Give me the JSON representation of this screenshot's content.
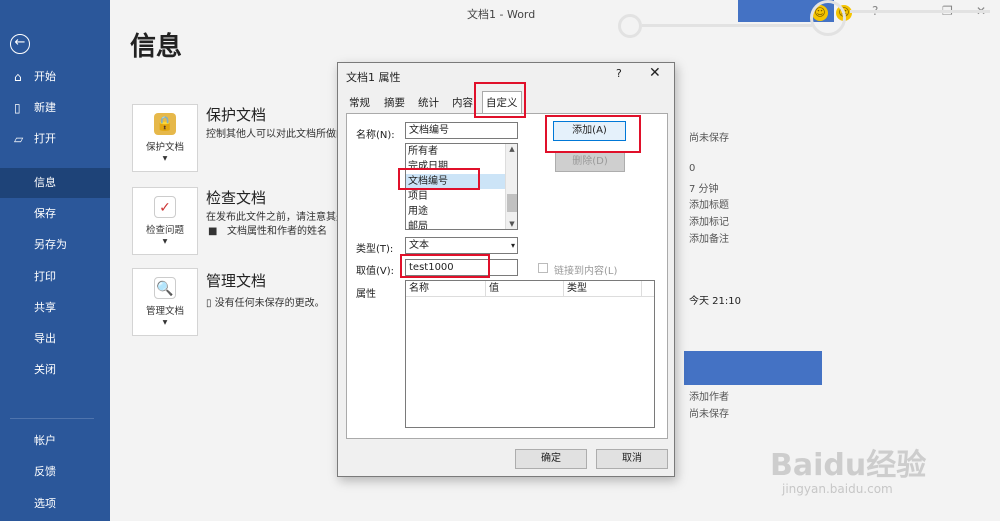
{
  "window": {
    "title": "文档1  -  Word"
  },
  "sidebar": {
    "back_icon": "back-arrow-icon",
    "items": [
      {
        "label": "开始",
        "icon": "home-icon"
      },
      {
        "label": "新建",
        "icon": "new-doc-icon"
      },
      {
        "label": "打开",
        "icon": "folder-icon"
      },
      {
        "label": "信息"
      },
      {
        "label": "保存"
      },
      {
        "label": "另存为"
      },
      {
        "label": "打印"
      },
      {
        "label": "共享"
      },
      {
        "label": "导出"
      },
      {
        "label": "关闭"
      },
      {
        "label": "帐户"
      },
      {
        "label": "反馈"
      },
      {
        "label": "选项"
      }
    ],
    "active": "信息"
  },
  "main": {
    "heading": "信息",
    "cards": [
      {
        "button_label": "保护文档",
        "title": "保护文档",
        "desc": "控制其他人可以对此文档所做的"
      },
      {
        "button_label": "检查问题",
        "title": "检查文档",
        "desc": "在发布此文件之前，请注意其是",
        "desc2": "文档属性和作者的姓名"
      },
      {
        "button_label": "管理文档",
        "title": "管理文档",
        "desc": "没有任何未保存的更改。"
      }
    ],
    "properties": {
      "unsaved": "尚未保存",
      "pages": "0",
      "edit_time": "7 分钟",
      "add_title": "添加标题",
      "add_tag": "添加标记",
      "add_comment": "添加备注",
      "today": "今天 21:10",
      "add_author": "添加作者",
      "last_saved": "尚未保存"
    }
  },
  "dialog": {
    "title": "文档1 属性",
    "help": "?",
    "close": "✕",
    "tabs": [
      "常规",
      "摘要",
      "统计",
      "内容",
      "自定义"
    ],
    "active_tab": "自定义",
    "name_label": "名称(N):",
    "name_value": "文档编号",
    "name_options": [
      "所有者",
      "完成日期",
      "文档编号",
      "项目",
      "用途",
      "邮局"
    ],
    "selected_option": "文档编号",
    "add_button": "添加(A)",
    "delete_button": "删除(D)",
    "type_label": "类型(T):",
    "type_value": "文本",
    "value_label": "取值(V):",
    "value_value": "test1000",
    "link_label": "链接到内容(L)",
    "props_label": "属性",
    "grid_headers": [
      "名称",
      "值",
      "类型"
    ],
    "ok_button": "确定",
    "cancel_button": "取消"
  },
  "watermark": {
    "main": "Baidu经验",
    "sub": "jingyan.baidu.com"
  },
  "colors": {
    "sidebar": "#2b579a",
    "accent": "#4472c4",
    "annotation": "#e0102a"
  }
}
